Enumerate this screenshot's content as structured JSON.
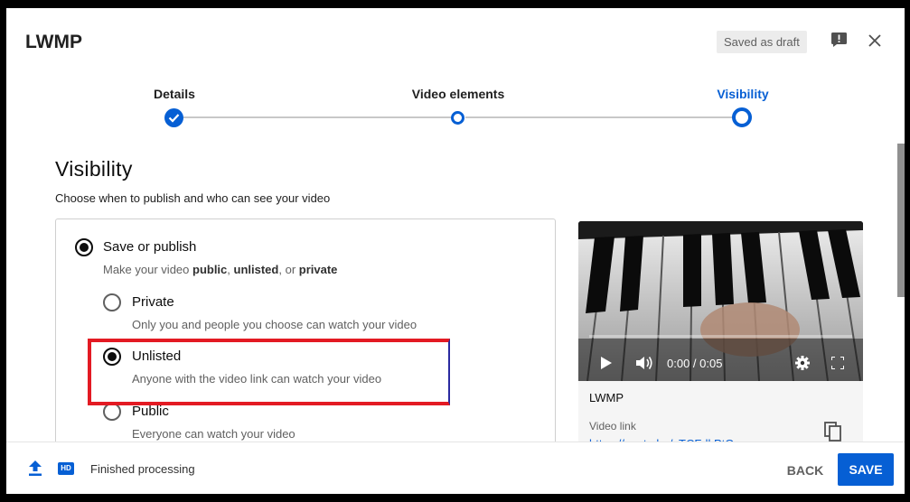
{
  "header": {
    "title": "LWMP",
    "draft_status": "Saved as draft"
  },
  "stepper": {
    "steps": [
      {
        "label": "Details",
        "state": "done"
      },
      {
        "label": "Video elements",
        "state": "upcoming"
      },
      {
        "label": "Visibility",
        "state": "current"
      }
    ]
  },
  "visibility": {
    "title": "Visibility",
    "subtitle": "Choose when to publish and who can see your video",
    "save_or_publish": {
      "label": "Save or publish",
      "desc_prefix": "Make your video ",
      "desc_public": "public",
      "desc_sep1": ", ",
      "desc_unlisted": "unlisted",
      "desc_sep2": ", or ",
      "desc_private": "private",
      "selected": true
    },
    "options": [
      {
        "label": "Private",
        "desc": "Only you and people you choose can watch your video",
        "selected": false
      },
      {
        "label": "Unlisted",
        "desc": "Anyone with the video link can watch your video",
        "selected": true
      },
      {
        "label": "Public",
        "desc": "Everyone can watch your video",
        "selected": false
      }
    ]
  },
  "preview": {
    "time": "0:00 / 0:05",
    "title": "LWMP",
    "link_label": "Video link",
    "link_value": "https://youtu.be/sTCFdkPtGqc"
  },
  "footer": {
    "hd_badge": "HD",
    "status": "Finished processing",
    "back_label": "BACK",
    "save_label": "SAVE"
  },
  "colors": {
    "accent": "#065fd4",
    "highlight": "#e31a23"
  }
}
